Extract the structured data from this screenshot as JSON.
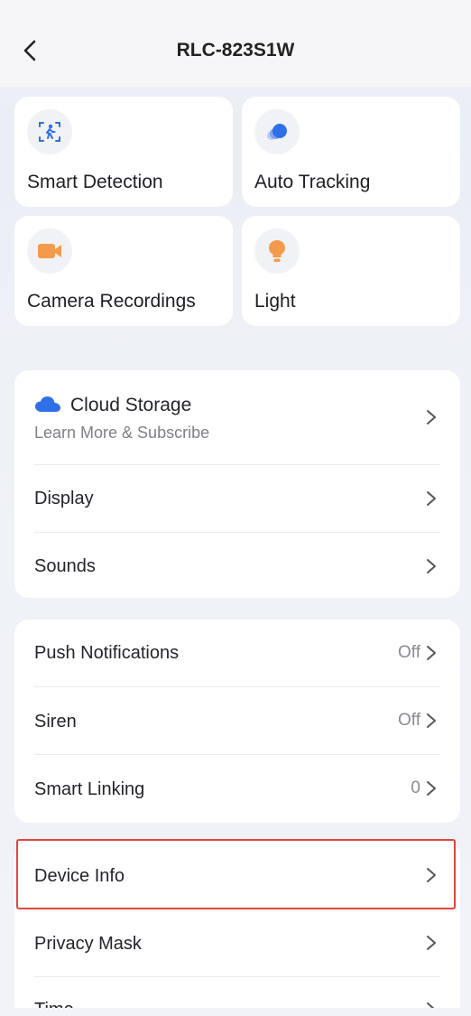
{
  "header": {
    "title": "RLC-823S1W",
    "back_icon": "chevron-left-icon"
  },
  "tiles": [
    {
      "label": "Smart Detection",
      "icon": "person-detect-icon",
      "color": "#2f6fe8"
    },
    {
      "label": "Auto Tracking",
      "icon": "tracking-dot-icon",
      "color": "#2f6fe8"
    },
    {
      "label": "Camera Recordings",
      "icon": "video-camera-icon",
      "color": "#f39a4c"
    },
    {
      "label": "Light",
      "icon": "light-bulb-icon",
      "color": "#f39a4c"
    }
  ],
  "cloud": {
    "title": "Cloud Storage",
    "subtitle": "Learn More & Subscribe",
    "icon": "cloud-icon",
    "color": "#2f6fe8"
  },
  "card1": {
    "display": "Display",
    "sounds": "Sounds"
  },
  "card2": {
    "push_label": "Push Notifications",
    "push_value": "Off",
    "siren_label": "Siren",
    "siren_value": "Off",
    "linking_label": "Smart Linking",
    "linking_value": "0"
  },
  "card3": {
    "device_info": "Device Info",
    "privacy_mask": "Privacy Mask",
    "time_partial": "Time"
  },
  "colors": {
    "highlight": "#e0463d",
    "accent": "#2f6fe8",
    "orange": "#f39a4c"
  }
}
